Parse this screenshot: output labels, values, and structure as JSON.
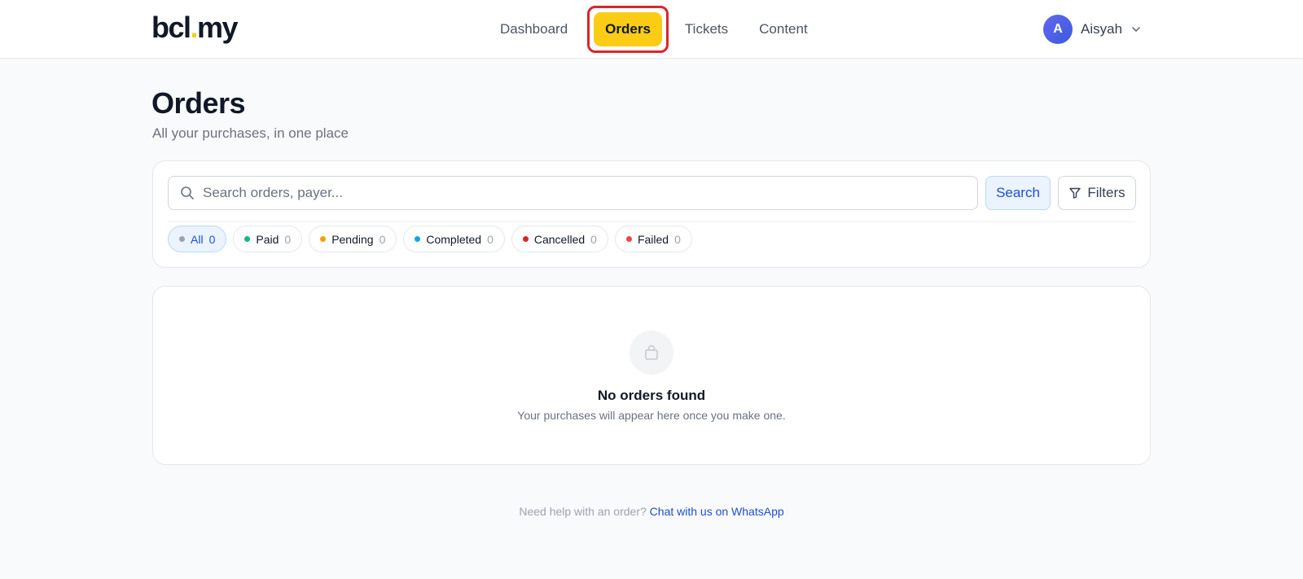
{
  "header": {
    "logo": {
      "part1": "bcl",
      "part2": ".",
      "part3": "my"
    },
    "nav": [
      {
        "label": "Dashboard"
      },
      {
        "label": "Orders"
      },
      {
        "label": "Tickets"
      },
      {
        "label": "Content"
      }
    ],
    "user": {
      "initial": "A",
      "name": "Aisyah"
    }
  },
  "page": {
    "title": "Orders",
    "subtitle": "All your purchases, in one place"
  },
  "filters": {
    "search_placeholder": "Search orders, payer...",
    "search_button": "Search",
    "filters_button": "Filters",
    "chips": [
      {
        "label": "All",
        "count": "0",
        "color": "#9ca3af"
      },
      {
        "label": "Paid",
        "count": "0",
        "color": "#10b981"
      },
      {
        "label": "Pending",
        "count": "0",
        "color": "#f59e0b"
      },
      {
        "label": "Completed",
        "count": "0",
        "color": "#0ea5e9"
      },
      {
        "label": "Cancelled",
        "count": "0",
        "color": "#dc2626"
      },
      {
        "label": "Failed",
        "count": "0",
        "color": "#ef4444"
      }
    ]
  },
  "empty_state": {
    "icon": "shopping-bag-icon",
    "title": "No orders found",
    "description": "Your purchases will appear here once you make one."
  },
  "help": {
    "text": "Need help with an order?",
    "link": "Chat with us on WhatsApp"
  },
  "colors": {
    "accent": "#facc15",
    "link": "#1d4ed8",
    "highlight_border": "#dc2626"
  }
}
